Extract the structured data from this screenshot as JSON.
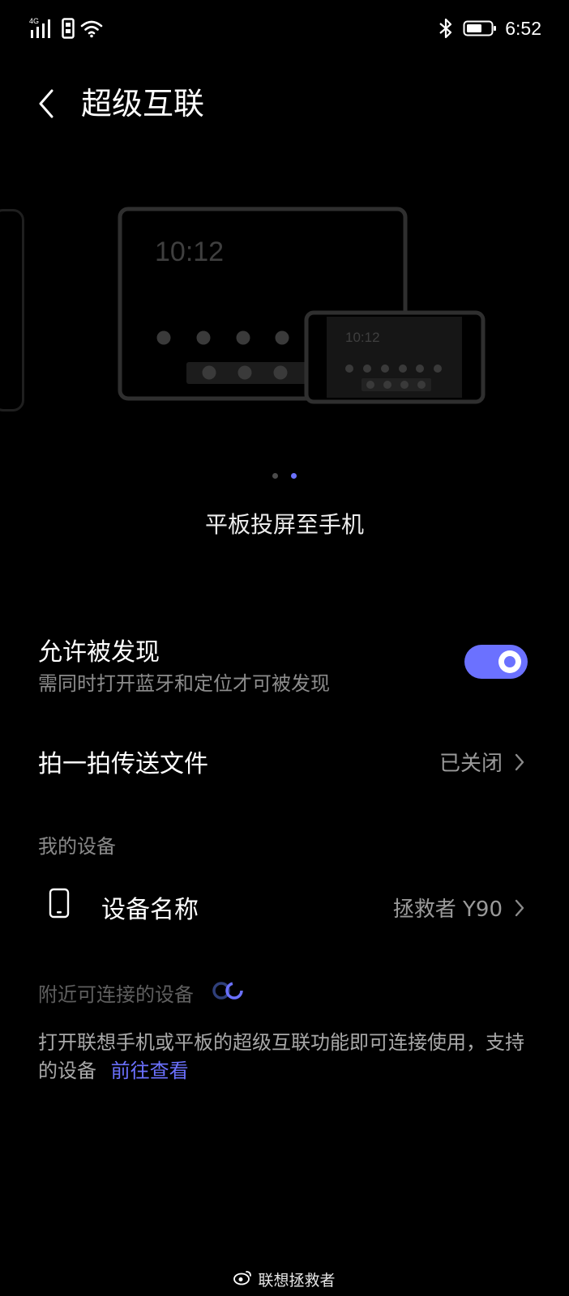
{
  "status_bar": {
    "network": "4G",
    "time": "6:52",
    "icons": [
      "signal-icon",
      "sim-icon",
      "wifi-icon",
      "bluetooth-icon",
      "battery-icon"
    ]
  },
  "header": {
    "title": "超级互联"
  },
  "illustration": {
    "tablet_time": "10:12",
    "phone_time": "10:12",
    "pages": 2,
    "active_page": 2,
    "caption": "平板投屏至手机"
  },
  "discoverable": {
    "title": "允许被发现",
    "subtitle": "需同时打开蓝牙和定位才可被发现",
    "enabled": true
  },
  "tap_transfer": {
    "title": "拍一拍传送文件",
    "value": "已关闭"
  },
  "my_devices": {
    "label": "我的设备",
    "device_name_title": "设备名称",
    "device_name_value": "拯救者 Y90"
  },
  "nearby": {
    "label": "附近可连接的设备",
    "info_text": "打开联想手机或平板的超级互联功能即可连接使用，支持的设备",
    "link_text": "前往查看"
  },
  "watermark": {
    "text": "联想拯救者"
  },
  "colors": {
    "accent": "#6b71ff",
    "background": "#000000"
  }
}
